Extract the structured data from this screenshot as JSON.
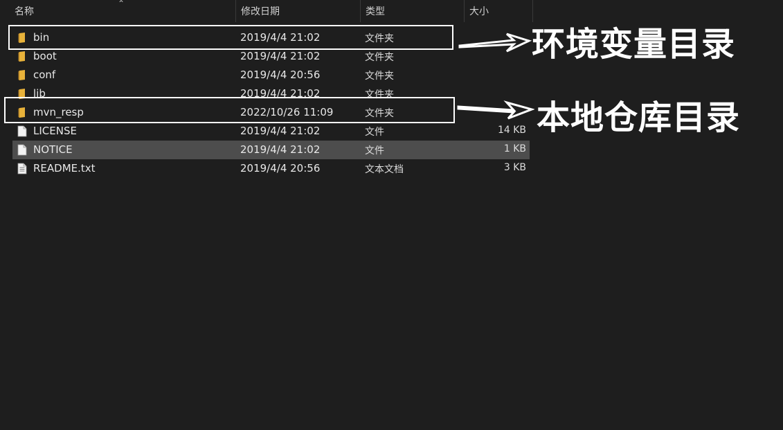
{
  "header": {
    "name": "名称",
    "date": "修改日期",
    "type": "类型",
    "size": "大小",
    "sort_indicator": "^"
  },
  "files": [
    {
      "name": "bin",
      "date": "2019/4/4 21:02",
      "type": "文件夹",
      "size": "",
      "kind": "folder"
    },
    {
      "name": "boot",
      "date": "2019/4/4 21:02",
      "type": "文件夹",
      "size": "",
      "kind": "folder"
    },
    {
      "name": "conf",
      "date": "2019/4/4 20:56",
      "type": "文件夹",
      "size": "",
      "kind": "folder"
    },
    {
      "name": "lib",
      "date": "2019/4/4 21:02",
      "type": "文件夹",
      "size": "",
      "kind": "folder"
    },
    {
      "name": "mvn_resp",
      "date": "2022/10/26 11:09",
      "type": "文件夹",
      "size": "",
      "kind": "folder"
    },
    {
      "name": "LICENSE",
      "date": "2019/4/4 21:02",
      "type": "文件",
      "size": "14 KB",
      "kind": "file"
    },
    {
      "name": "NOTICE",
      "date": "2019/4/4 21:02",
      "type": "文件",
      "size": "1 KB",
      "kind": "file",
      "selected": true
    },
    {
      "name": "README.txt",
      "date": "2019/4/4 20:56",
      "type": "文本文档",
      "size": "3 KB",
      "kind": "text"
    }
  ],
  "annotations": {
    "env_label": "环境变量目录",
    "repo_label": "本地仓库目录"
  },
  "colors": {
    "background": "#1e1e1e",
    "selected_row": "#4d4d4d",
    "folder": "#e8b23a",
    "annotation": "#ffffff"
  }
}
